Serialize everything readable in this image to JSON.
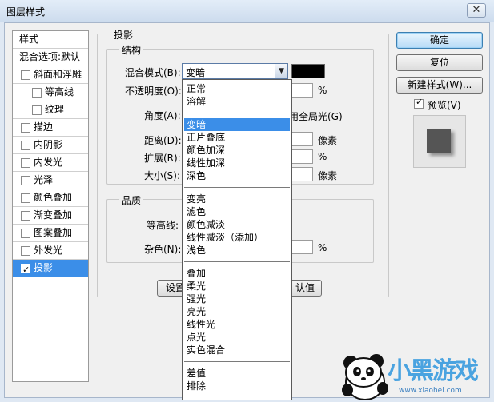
{
  "window": {
    "title": "图层样式",
    "close_glyph": "✕"
  },
  "styles_list": {
    "items": [
      {
        "label": "样式",
        "kind": "plain",
        "checked": false,
        "indent": false
      },
      {
        "label": "混合选项:默认",
        "kind": "plain",
        "checked": false,
        "indent": false
      },
      {
        "label": "斜面和浮雕",
        "kind": "check",
        "checked": false,
        "indent": false
      },
      {
        "label": "等高线",
        "kind": "check",
        "checked": false,
        "indent": true
      },
      {
        "label": "纹理",
        "kind": "check",
        "checked": false,
        "indent": true
      },
      {
        "label": "描边",
        "kind": "check",
        "checked": false,
        "indent": false
      },
      {
        "label": "内阴影",
        "kind": "check",
        "checked": false,
        "indent": false
      },
      {
        "label": "内发光",
        "kind": "check",
        "checked": false,
        "indent": false
      },
      {
        "label": "光泽",
        "kind": "check",
        "checked": false,
        "indent": false
      },
      {
        "label": "颜色叠加",
        "kind": "check",
        "checked": false,
        "indent": false
      },
      {
        "label": "渐变叠加",
        "kind": "check",
        "checked": false,
        "indent": false
      },
      {
        "label": "图案叠加",
        "kind": "check",
        "checked": false,
        "indent": false
      },
      {
        "label": "外发光",
        "kind": "check",
        "checked": false,
        "indent": false
      },
      {
        "label": "投影",
        "kind": "check",
        "checked": true,
        "indent": false,
        "active": true
      }
    ]
  },
  "shadow": {
    "section_title": "投影",
    "structure": {
      "title": "结构",
      "blend_mode_label": "混合模式(B):",
      "blend_mode_value": "变暗",
      "shadow_color": "#000000",
      "opacity_label": "不透明度(O):",
      "opacity_unit": "%",
      "angle_label": "角度(A):",
      "global_light_label": "用全局光(G)",
      "distance_label": "距离(D):",
      "distance_unit": "像素",
      "spread_label": "扩展(R):",
      "spread_unit": "%",
      "size_label": "大小(S):",
      "size_unit": "像素"
    },
    "quality": {
      "title": "品质",
      "contour_label": "等高线:",
      "noise_label": "杂色(N):",
      "noise_unit": "%"
    },
    "set_default_partial": "设置",
    "reset_default_partial": "认值"
  },
  "blend_dropdown": {
    "groups": [
      [
        "正常",
        "溶解"
      ],
      [
        "变暗",
        "正片叠底",
        "颜色加深",
        "线性加深",
        "深色"
      ],
      [
        "变亮",
        "滤色",
        "颜色减淡",
        "线性减淡（添加）",
        "浅色"
      ],
      [
        "叠加",
        "柔光",
        "强光",
        "亮光",
        "线性光",
        "点光",
        "实色混合"
      ],
      [
        "差值",
        "排除"
      ]
    ],
    "selected": "变暗"
  },
  "buttons": {
    "ok": "确定",
    "reset": "复位",
    "new_style": "新建样式(W)...",
    "preview_label": "预览(V)",
    "preview_checked": true
  },
  "watermark": {
    "text": "小黑游戏",
    "url": "www.xiaohei.com"
  }
}
